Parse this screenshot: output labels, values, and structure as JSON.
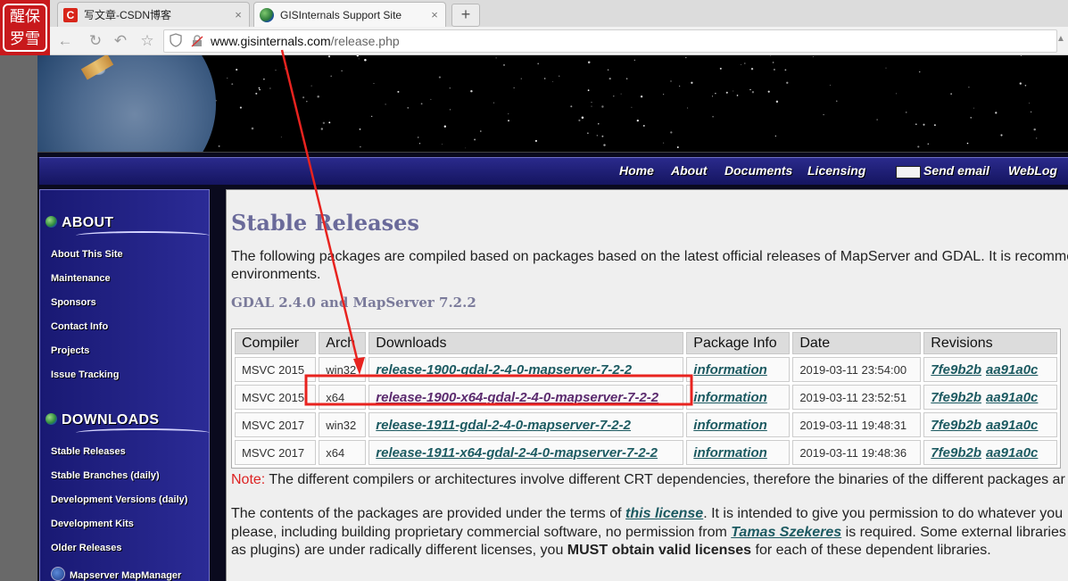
{
  "browser": {
    "logo_text": [
      "醒",
      "保",
      "罗",
      "雪"
    ],
    "tabs": [
      {
        "title": "写文章-CSDN博客",
        "favicon": "C",
        "close": "×"
      },
      {
        "title": "GISInternals Support Site",
        "close": "×"
      }
    ],
    "new_tab": "+",
    "url_host": "www.gisinternals.com",
    "url_path": "/release.php"
  },
  "nav": {
    "links": [
      "Home",
      "About",
      "Documents",
      "Licensing",
      "Send email",
      "WebLog"
    ]
  },
  "sidebar": {
    "about_heading": "ABOUT",
    "about_links": [
      "About This Site",
      "Maintenance",
      "Sponsors",
      "Contact Info",
      "Projects",
      "Issue Tracking"
    ],
    "downloads_heading": "DOWNLOADS",
    "download_links": [
      "Stable Releases",
      "Stable Branches (daily)",
      "Development Versions (daily)",
      "Development Kits",
      "Older Releases",
      "Mapserver MapManager"
    ]
  },
  "content": {
    "title": "Stable Releases",
    "intro_line1": "The following packages are compiled based on packages based on the latest official releases of MapServer and GDAL. It is recommer",
    "intro_line2": "environments.",
    "section_title": "GDAL 2.4.0 and MapServer 7.2.2",
    "table": {
      "headers": [
        "Compiler",
        "Arch",
        "Downloads",
        "Package Info",
        "Date",
        "Revisions"
      ],
      "rows": [
        {
          "compiler": "MSVC 2015",
          "arch": "win32",
          "download": "release-1900-gdal-2-4-0-mapserver-7-2-2",
          "info": "information",
          "date": "2019-03-11 23:54:00",
          "rev1": "7fe9b2b",
          "rev2": "aa91a0c"
        },
        {
          "compiler": "MSVC 2015",
          "arch": "x64",
          "download": "release-1900-x64-gdal-2-4-0-mapserver-7-2-2",
          "info": "information",
          "date": "2019-03-11 23:52:51",
          "rev1": "7fe9b2b",
          "rev2": "aa91a0c"
        },
        {
          "compiler": "MSVC 2017",
          "arch": "win32",
          "download": "release-1911-gdal-2-4-0-mapserver-7-2-2",
          "info": "information",
          "date": "2019-03-11 19:48:31",
          "rev1": "7fe9b2b",
          "rev2": "aa91a0c"
        },
        {
          "compiler": "MSVC 2017",
          "arch": "x64",
          "download": "release-1911-x64-gdal-2-4-0-mapserver-7-2-2",
          "info": "information",
          "date": "2019-03-11 19:48:36",
          "rev1": "7fe9b2b",
          "rev2": "aa91a0c"
        }
      ]
    },
    "note_label": "Note:",
    "note_text": " The different compilers or architectures involve different CRT dependencies, therefore the binaries of the different packages ar",
    "license_1a": "The contents of the packages are provided under the terms of ",
    "license_link": "this license",
    "license_1b": ". It is intended to give you permission to do whatever you",
    "license_2a": "please, including building proprietary commercial software, no permission from ",
    "license_author": "Tamas Szekeres",
    "license_2b": " is required. Some external libraries w",
    "license_3a": "as plugins) are under radically different licenses, you ",
    "license_bold": "MUST obtain valid licenses",
    "license_3b": " for each of these dependent libraries."
  },
  "annotation": {
    "color": "#e8231f"
  }
}
